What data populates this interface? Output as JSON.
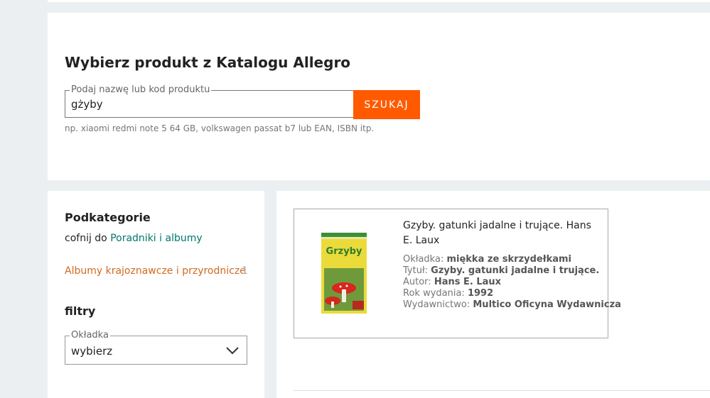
{
  "search": {
    "heading": "Wybierz produkt z Katalogu Allegro",
    "legend": "Podaj nazwę lub kod produktu",
    "value": "gżyby",
    "button": "SZUKAJ",
    "hint": "np. xiaomi redmi note 5 64 GB, volkswagen passat b7 lub EAN, ISBN itp."
  },
  "sidebar": {
    "subcategories_title": "Podkategorie",
    "back_prefix": "cofnij do",
    "back_link": "Poradniki i albumy",
    "subcategory": {
      "label": "Albumy krajoznawcze i przyrodnicze",
      "count": "1"
    },
    "filters_title": "filtry",
    "cover_filter": {
      "legend": "Okładka",
      "value": "wybierz",
      "icon": "chevron-down-icon"
    }
  },
  "product": {
    "title": "Gzyby. gatunki jadalne i trujące. Hans E. Laux",
    "cover_title_text": "Grzyby",
    "attributes": [
      {
        "label": "Okładka:",
        "value": "miękka ze skrzydełkami"
      },
      {
        "label": "Tytuł:",
        "value": "Gzyby. gatunki jadalne i trujące."
      },
      {
        "label": "Autor:",
        "value": "Hans E. Laux"
      },
      {
        "label": "Rok wydania:",
        "value": "1992"
      },
      {
        "label": "Wydawnictwo:",
        "value": "Multico Oficyna Wydawnicza"
      }
    ]
  },
  "colors": {
    "accent": "#ff5a00",
    "link_green": "#00776b",
    "link_orange": "#d2691e"
  }
}
